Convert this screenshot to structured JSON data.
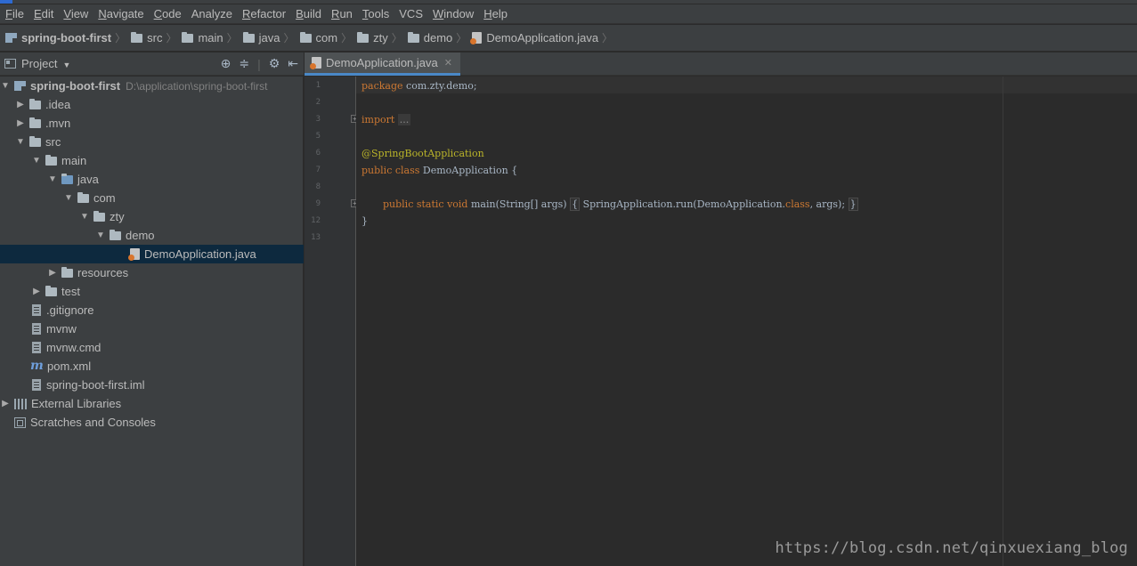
{
  "menu": [
    {
      "mnemonic": "F",
      "rest": "ile"
    },
    {
      "mnemonic": "E",
      "rest": "dit"
    },
    {
      "mnemonic": "V",
      "rest": "iew"
    },
    {
      "mnemonic": "N",
      "rest": "avigate"
    },
    {
      "mnemonic": "C",
      "rest": "ode"
    },
    {
      "mnemonic": "",
      "rest": "Analyze"
    },
    {
      "mnemonic": "R",
      "rest": "efactor"
    },
    {
      "mnemonic": "B",
      "rest": "uild"
    },
    {
      "mnemonic": "R",
      "rest": "un"
    },
    {
      "mnemonic": "T",
      "rest": "ools"
    },
    {
      "mnemonic": "",
      "rest": "VCS"
    },
    {
      "mnemonic": "W",
      "rest": "indow"
    },
    {
      "mnemonic": "H",
      "rest": "elp"
    }
  ],
  "breadcrumbs": [
    "spring-boot-first",
    "src",
    "main",
    "java",
    "com",
    "zty",
    "demo",
    "DemoApplication.java"
  ],
  "project_panel": {
    "title": "Project"
  },
  "tree": {
    "root_name": "spring-boot-first",
    "root_path": "D:\\application\\spring-boot-first",
    "idea": ".idea",
    "mvn": ".mvn",
    "src": "src",
    "main": "main",
    "java": "java",
    "com": "com",
    "zty": "zty",
    "demo": "demo",
    "demo_app": "DemoApplication.java",
    "resources": "resources",
    "test": "test",
    "gitignore": ".gitignore",
    "mvnw": "mvnw",
    "mvnw_cmd": "mvnw.cmd",
    "pom": "pom.xml",
    "iml": "spring-boot-first.iml",
    "external_libs": "External Libraries",
    "scratches": "Scratches and Consoles"
  },
  "editor_tab": {
    "label": "DemoApplication.java"
  },
  "line_numbers": [
    "1",
    "2",
    "3",
    "5",
    "6",
    "7",
    "8",
    "9",
    "12",
    "13"
  ],
  "code": {
    "l1_kw": "package",
    "l1_rest": " com.zty.demo;",
    "l3_kw": "import",
    "l3_fold": "...",
    "l6_ann": "@SpringBootApplication",
    "l7_kw": "public class",
    "l7_rest": " DemoApplication {",
    "l9_kw": "public static void",
    "l9_rest": " main(String[] args) ",
    "l9_fold_open": "{",
    "l9_body": " SpringApplication.run(DemoApplication.",
    "l9_kw2": "class",
    "l9_body2": ", args); ",
    "l9_fold_close": "}",
    "l12": "}"
  },
  "watermark": "https://blog.csdn.net/qinxuexiang_blog",
  "colors": {
    "background": "#2b2b2b",
    "panel": "#3c3f41",
    "keyword": "#cc7832",
    "annotation": "#bbb529",
    "selection": "#0d293e",
    "tab_underline": "#4a88c7"
  }
}
